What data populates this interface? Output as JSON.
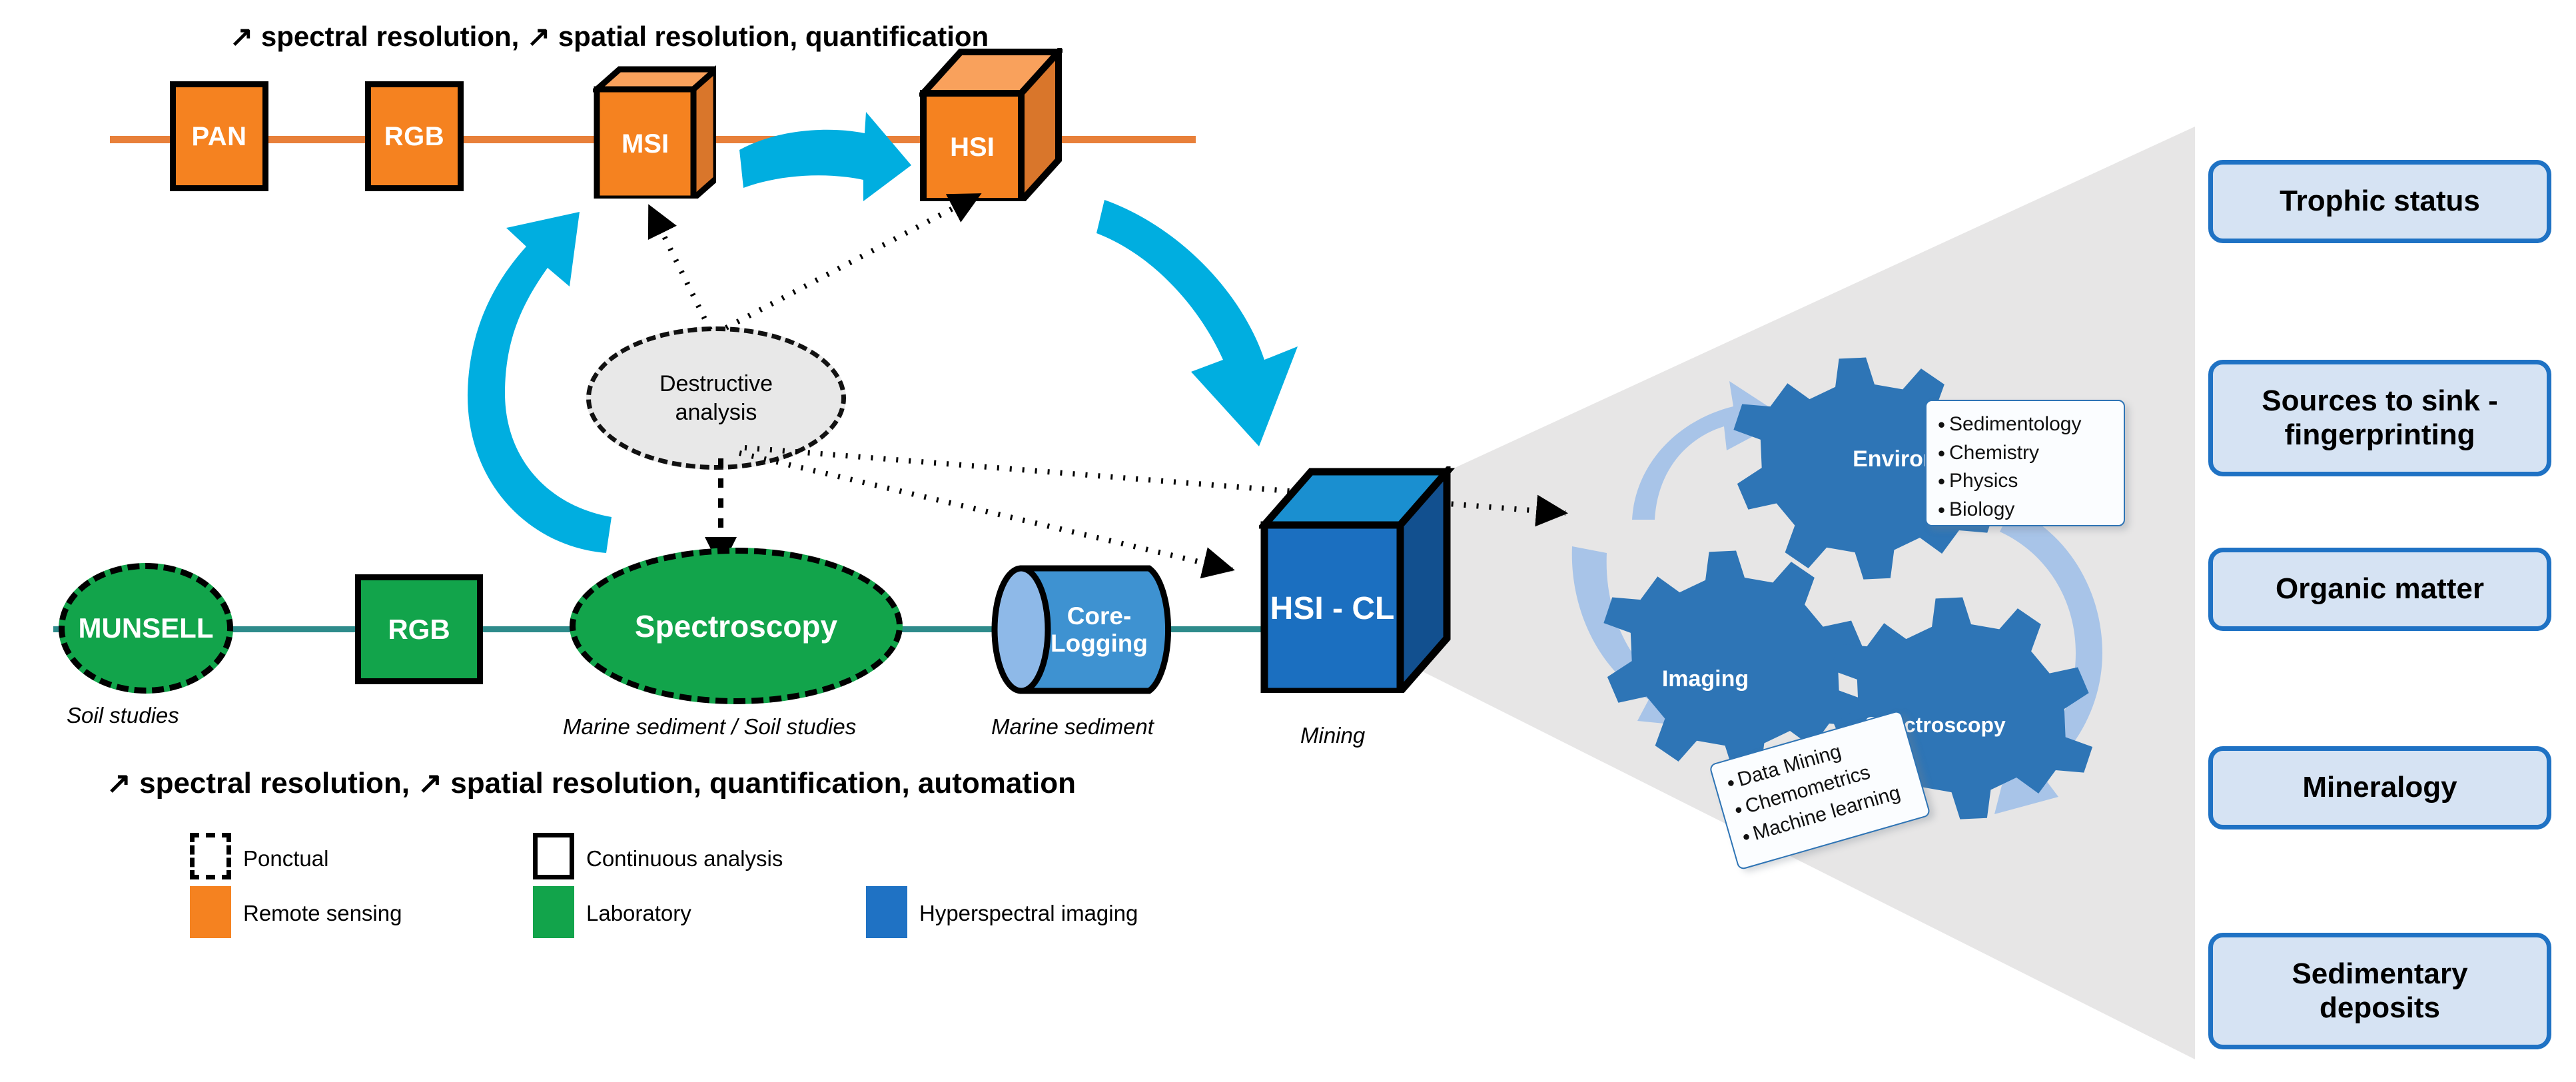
{
  "headings": {
    "top": "↗ spectral resolution, ↗ spatial resolution, quantification",
    "bottom": "↗ spectral resolution, ↗ spatial resolution, quantification, automation"
  },
  "remote_sensing_row": {
    "nodes": [
      {
        "label": "PAN",
        "shape": "rect"
      },
      {
        "label": "RGB",
        "shape": "rect"
      },
      {
        "label": "MSI",
        "shape": "cube"
      },
      {
        "label": "HSI",
        "shape": "cube"
      }
    ]
  },
  "destructive": {
    "line1": "Destructive",
    "line2": "analysis"
  },
  "laboratory_row": {
    "nodes": [
      {
        "label": "MUNSELL",
        "shape": "ellipse-dashed",
        "caption": "Soil studies"
      },
      {
        "label": "RGB",
        "shape": "rect",
        "caption": ""
      },
      {
        "label": "Spectroscopy",
        "shape": "ellipse-dashed",
        "caption": "Marine sediment / Soil studies"
      },
      {
        "label": "Core-\nLogging",
        "label_l1": "Core-",
        "label_l2": "Logging",
        "shape": "cylinder",
        "caption": "Marine sediment"
      },
      {
        "label": "HSI - CL",
        "shape": "cube",
        "caption": "Mining"
      }
    ]
  },
  "legend": {
    "items": [
      {
        "label": "Ponctual",
        "style": "dashed-outline"
      },
      {
        "label": "Continuous analysis",
        "style": "solid-outline"
      },
      {
        "label": "Remote sensing",
        "style": "fill",
        "color": "#F58220"
      },
      {
        "label": "Laboratory",
        "style": "fill",
        "color": "#12A44B"
      },
      {
        "label": "Hyperspectral imaging",
        "style": "fill",
        "color": "#1F72C4"
      }
    ]
  },
  "gears": {
    "items": [
      {
        "label": "Environment"
      },
      {
        "label": "Imaging"
      },
      {
        "label": "Spectroscopy"
      }
    ],
    "callout_environment": [
      "Sedimentology",
      "Chemistry",
      "Physics",
      "Biology"
    ],
    "callout_imaging": [
      "Data Mining",
      "Chemometrics",
      "Machine learning"
    ]
  },
  "results": {
    "items": [
      {
        "label": "Trophic status"
      },
      {
        "label": "Sources to sink -\nfingerprinting",
        "l1": "Sources to sink -",
        "l2": "fingerprinting"
      },
      {
        "label": "Organic matter"
      },
      {
        "label": "Mineralogy"
      },
      {
        "label": "Sedimentary\ndeposits",
        "l1": "Sedimentary",
        "l2": "deposits"
      }
    ]
  },
  "colors": {
    "remote_sensing": "#F58220",
    "laboratory": "#12A44B",
    "hyperspectral": "#1F72C4",
    "arrow_cyan": "#00AEE0",
    "gear_blue": "#2E75B6",
    "wedge_gray": "#E7E6E6"
  }
}
